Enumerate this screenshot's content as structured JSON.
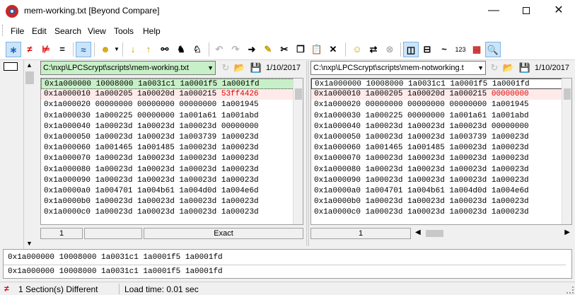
{
  "window": {
    "title": "mem-working.txt  [Beyond Compare]"
  },
  "menu": {
    "items": [
      "File",
      "Edit",
      "Search",
      "View",
      "Tools",
      "Help"
    ]
  },
  "toolbar": {
    "number_icon": "123"
  },
  "left": {
    "path": "C:\\nxp\\LPCScrypt\\scripts\\mem-working.txt",
    "date": "1/10/2017",
    "lines": [
      {
        "text": "0x1a000000 10008000 1a0031c1 1a0001f5 1a0001fd",
        "diff": ""
      },
      {
        "text": "0x1a000010 1a000205 1a00020d 1a000215 ",
        "diff": "53ff4426"
      },
      {
        "text": "0x1a000020 00000000 00000000 00000000 1a001945",
        "diff": ""
      },
      {
        "text": "0x1a000030 1a000225 00000000 1a001a61 1a001abd",
        "diff": ""
      },
      {
        "text": "0x1a000040 1a00023d 1a00023d 1a00023d 00000000",
        "diff": ""
      },
      {
        "text": "0x1a000050 1a00023d 1a00023d 1a003739 1a00023d",
        "diff": ""
      },
      {
        "text": "0x1a000060 1a001465 1a001485 1a00023d 1a00023d",
        "diff": ""
      },
      {
        "text": "0x1a000070 1a00023d 1a00023d 1a00023d 1a00023d",
        "diff": ""
      },
      {
        "text": "0x1a000080 1a00023d 1a00023d 1a00023d 1a00023d",
        "diff": ""
      },
      {
        "text": "0x1a000090 1a00023d 1a00023d 1a00023d 1a00023d",
        "diff": ""
      },
      {
        "text": "0x1a0000a0 1a004701 1a004b61 1a004d0d 1a004e6d",
        "diff": ""
      },
      {
        "text": "0x1a0000b0 1a00023d 1a00023d 1a00023d 1a00023d",
        "diff": ""
      },
      {
        "text": "0x1a0000c0 1a00023d 1a00023d 1a00023d 1a00023d",
        "diff": ""
      }
    ],
    "status_line": "1",
    "status_match": "Exact"
  },
  "right": {
    "path": "C:\\nxp\\LPCScrypt\\scripts\\mem-notworking.t",
    "date": "1/10/2017",
    "lines": [
      {
        "text": "0x1a000000 10008000 1a0031c1 1a0001f5 1a0001fd",
        "diff": ""
      },
      {
        "text": "0x1a000010 1a000205 1a00020d 1a000215 ",
        "diff": "00000000"
      },
      {
        "text": "0x1a000020 00000000 00000000 00000000 1a001945",
        "diff": ""
      },
      {
        "text": "0x1a000030 1a000225 00000000 1a001a61 1a001abd",
        "diff": ""
      },
      {
        "text": "0x1a000040 1a00023d 1a00023d 1a00023d 00000000",
        "diff": ""
      },
      {
        "text": "0x1a000050 1a00023d 1a00023d 1a003739 1a00023d",
        "diff": ""
      },
      {
        "text": "0x1a000060 1a001465 1a001485 1a00023d 1a00023d",
        "diff": ""
      },
      {
        "text": "0x1a000070 1a00023d 1a00023d 1a00023d 1a00023d",
        "diff": ""
      },
      {
        "text": "0x1a000080 1a00023d 1a00023d 1a00023d 1a00023d",
        "diff": ""
      },
      {
        "text": "0x1a000090 1a00023d 1a00023d 1a00023d 1a00023d",
        "diff": ""
      },
      {
        "text": "0x1a0000a0 1a004701 1a004b61 1a004d0d 1a004e6d",
        "diff": ""
      },
      {
        "text": "0x1a0000b0 1a00023d 1a00023d 1a00023d 1a00023d",
        "diff": ""
      },
      {
        "text": "0x1a0000c0 1a00023d 1a00023d 1a00023d 1a00023d",
        "diff": ""
      }
    ],
    "status_line": "1"
  },
  "bottom": {
    "line1": "0x1a000000 10008000 1a0031c1 1a0001f5 1a0001fd",
    "line2": "0x1a000000 10008000 1a0031c1 1a0001f5 1a0001fd"
  },
  "status": {
    "sections": "1 Section(s) Different",
    "load_time": "Load time:  0.01 sec"
  },
  "colors": {
    "same_bg": "#c8f0c8",
    "diff_text": "#e00000",
    "active_btn": "#cce4f7"
  }
}
